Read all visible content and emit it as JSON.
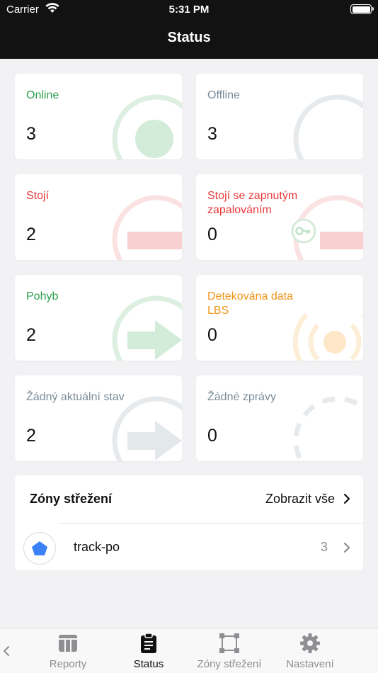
{
  "status_bar": {
    "carrier": "Carrier",
    "time": "5:31 PM"
  },
  "nav": {
    "title": "Status"
  },
  "cards": {
    "online": {
      "label": "Online",
      "value": "3",
      "color": "#2e9e4f"
    },
    "offline": {
      "label": "Offline",
      "value": "3",
      "color": "#7a8b97"
    },
    "stoji": {
      "label": "Stojí",
      "value": "2",
      "color": "#e8393a"
    },
    "stoji_zap": {
      "label": "Stojí se zapnutým zapalováním",
      "value": "0",
      "color": "#e8393a"
    },
    "pohyb": {
      "label": "Pohyb",
      "value": "2",
      "color": "#2e9e4f"
    },
    "lbs": {
      "label": "Detekována data LBS",
      "value": "0",
      "color": "#f0961c"
    },
    "zadny": {
      "label": "Žádný aktuální stav",
      "value": "2",
      "color": "#7a8b97"
    },
    "zpravy": {
      "label": "Žádné zprávy",
      "value": "0",
      "color": "#7a8b97"
    }
  },
  "zones": {
    "title": "Zóny střežení",
    "show_all": "Zobrazit vše",
    "items": [
      {
        "name": "track-po",
        "count": "3",
        "icon": "pentagon-icon",
        "icon_color": "#3b82f6"
      }
    ]
  },
  "tabbar": {
    "tabs": [
      {
        "label": "Reporty",
        "icon": "table-icon",
        "active": false
      },
      {
        "label": "Status",
        "icon": "clipboard-icon",
        "active": true
      },
      {
        "label": "Zóny střežení",
        "icon": "zone-square-icon",
        "active": false
      },
      {
        "label": "Nastavení",
        "icon": "gear-icon",
        "active": false
      }
    ]
  }
}
